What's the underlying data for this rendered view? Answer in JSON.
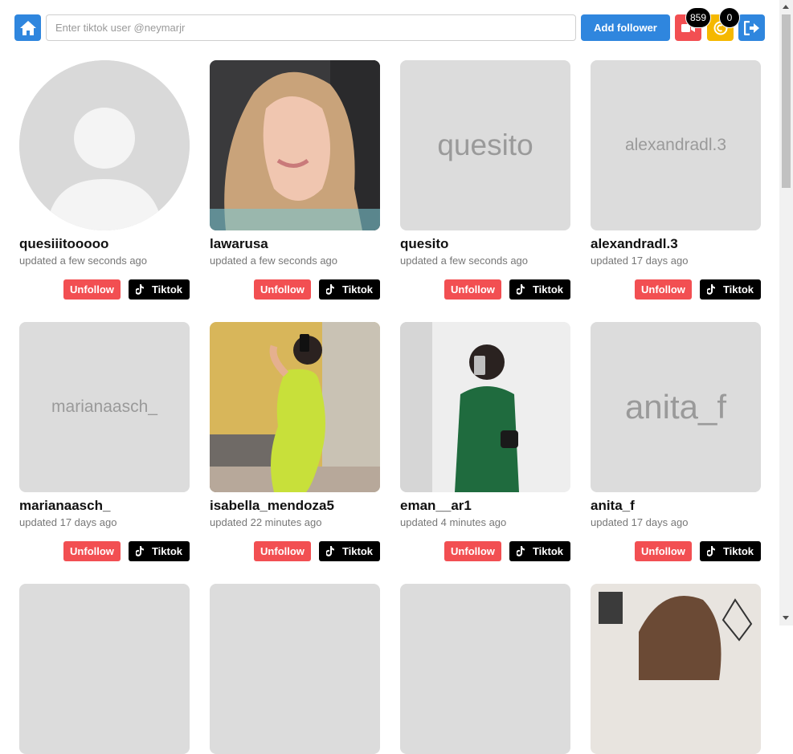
{
  "search": {
    "placeholder": "Enter tiktok user @neymarjr"
  },
  "toolbar": {
    "add_label": "Add follower",
    "video_count": "859",
    "coin_count": "0"
  },
  "colors": {
    "primary": "#2f86de",
    "danger": "#f24f52",
    "warning": "#f5b800",
    "placeholder": "#dcdcdc"
  },
  "labels": {
    "unfollow": "Unfollow",
    "tiktok": "Tiktok"
  },
  "users": [
    {
      "username": "quesiiitooooo",
      "updated": "updated a few seconds ago",
      "thumb": "default-avatar"
    },
    {
      "username": "lawarusa",
      "updated": "updated a few seconds ago",
      "thumb": "photo"
    },
    {
      "username": "quesito",
      "updated": "updated a few seconds ago",
      "thumb": "text",
      "thumb_text": "quesito"
    },
    {
      "username": "alexandradl.3",
      "updated": "updated 17 days ago",
      "thumb": "text",
      "thumb_text": "alexandradl.3"
    },
    {
      "username": "marianaasch_",
      "updated": "updated 17 days ago",
      "thumb": "text",
      "thumb_text": "marianaasch_"
    },
    {
      "username": "isabella_mendoza5",
      "updated": "updated 22 minutes ago",
      "thumb": "photo"
    },
    {
      "username": "eman__ar1",
      "updated": "updated 4 minutes ago",
      "thumb": "photo"
    },
    {
      "username": "anita_f",
      "updated": "updated 17 days ago",
      "thumb": "text",
      "thumb_text": "anita_f"
    }
  ]
}
